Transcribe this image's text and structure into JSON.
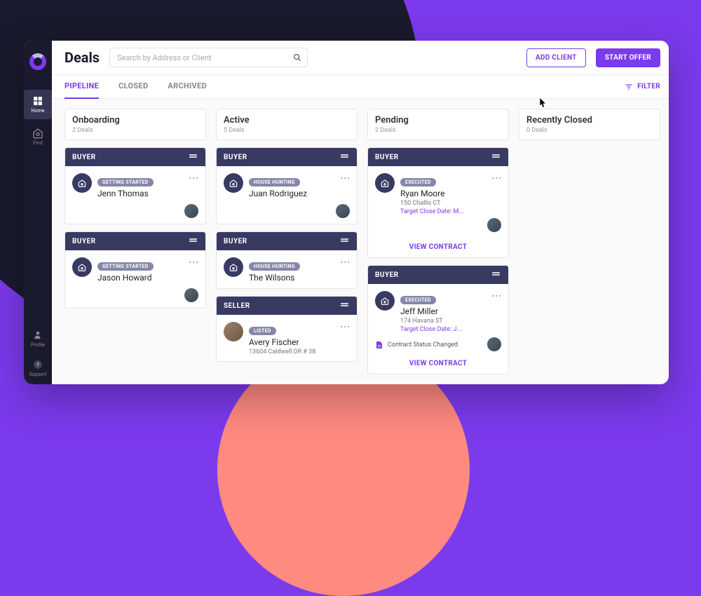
{
  "header": {
    "title": "Deals",
    "search_placeholder": "Search by Address or Client",
    "add_client": "ADD CLIENT",
    "start_offer": "START OFFER"
  },
  "sidebar": {
    "home": "Home",
    "find": "Find",
    "profile": "Profile",
    "support": "Support"
  },
  "tabs": {
    "pipeline": "PIPELINE",
    "closed": "CLOSED",
    "archived": "ARCHIVED"
  },
  "filter_label": "FILTER",
  "columns": {
    "onboarding": {
      "title": "Onboarding",
      "count": "2 Deals"
    },
    "active": {
      "title": "Active",
      "count": "5 Deals"
    },
    "pending": {
      "title": "Pending",
      "count": "2 Deals"
    },
    "recently_closed": {
      "title": "Recently Closed",
      "count": "0 Deals"
    }
  },
  "labels": {
    "buyer": "BUYER",
    "seller": "SELLER",
    "view_contract": "VIEW CONTRACT",
    "contract_status_changed": "Contract Status Changed"
  },
  "badges": {
    "getting_started": "GETTING STARTED",
    "house_hunting": "HOUSE HUNTING",
    "executed": "EXECUTED",
    "listed": "LISTED"
  },
  "cards": {
    "jenn": {
      "name": "Jenn Thomas"
    },
    "jason": {
      "name": "Jason Howard"
    },
    "juan": {
      "name": "Juan Rodriguez"
    },
    "wilsons": {
      "name": "The Wilsons"
    },
    "avery": {
      "name": "Avery Fischer",
      "address": "13604 Caldwell DR # 38"
    },
    "ryan": {
      "name": "Ryan Moore",
      "address": "150 Challis CT",
      "target": "Target Close Date: M..."
    },
    "jeff": {
      "name": "Jeff Miller",
      "address": "174 Havana ST",
      "target": "Target Close Date: J..."
    }
  }
}
